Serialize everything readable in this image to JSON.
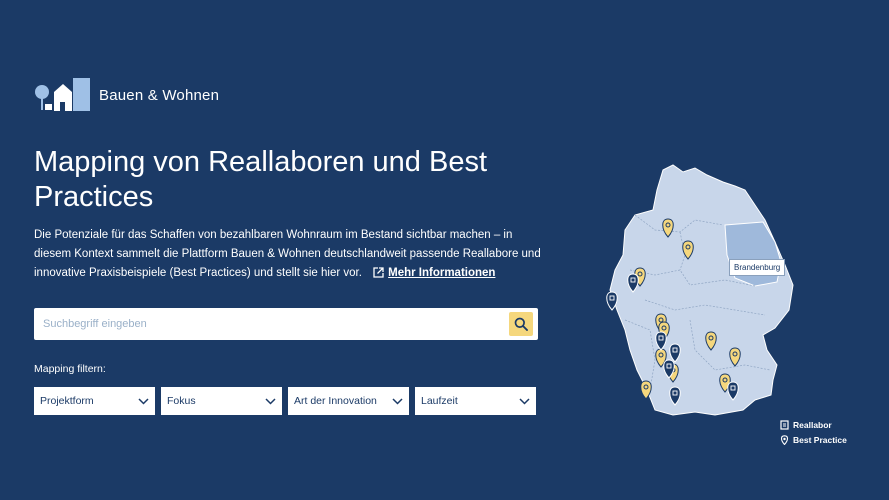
{
  "brand": {
    "name": "Bauen & Wohnen"
  },
  "hero": {
    "title": "Mapping von Reallaboren und Best Practices",
    "description": "Die Potenziale für das Schaffen von bezahlbaren Wohnraum im Bestand sichtbar machen – in diesem Kontext sammelt die Plattform Bauen & Wohnen deutschlandweit passende Reallabore und innovative Praxisbeispiele (Best Practices) und stellt sie hier vor.",
    "more_link": "Mehr Informationen"
  },
  "search": {
    "placeholder": "Suchbegriff eingeben"
  },
  "filters": {
    "label": "Mapping filtern:",
    "items": [
      {
        "label": "Projektform"
      },
      {
        "label": "Fokus"
      },
      {
        "label": "Art der Innovation"
      },
      {
        "label": "Laufzeit"
      }
    ]
  },
  "map": {
    "highlight_label": "Brandenburg",
    "legend": [
      {
        "label": "Reallabor",
        "icon": "reallabor-icon"
      },
      {
        "label": "Best Practice",
        "icon": "best-practice-icon"
      }
    ]
  },
  "colors": {
    "background": "#1b3a66",
    "map_fill": "#c8d6ea",
    "highlight": "#9fb9db",
    "best_practice_pin": "#f5d77d",
    "reallabor_pin": "#1b3a66"
  }
}
